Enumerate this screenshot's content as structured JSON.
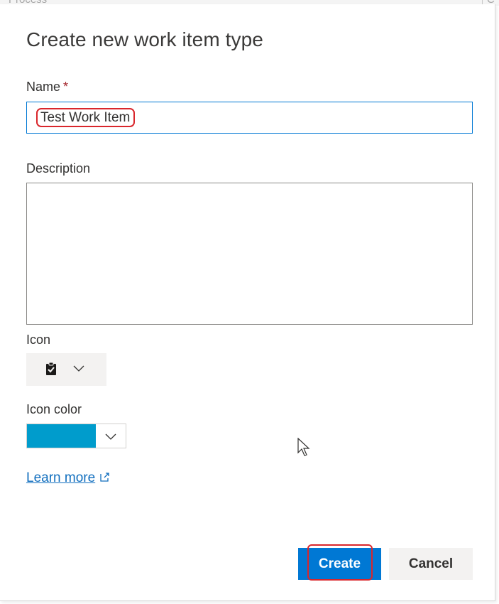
{
  "background": {
    "left_text": "Process",
    "right_text": "C"
  },
  "dialog": {
    "title": "Create new work item type",
    "name": {
      "label": "Name",
      "required_mark": "*",
      "value": "Test Work Item"
    },
    "description": {
      "label": "Description",
      "value": ""
    },
    "icon": {
      "label": "Icon",
      "selected_icon": "clipboard-check-icon"
    },
    "icon_color": {
      "label": "Icon color",
      "selected_color": "#009CCC"
    },
    "learn_more": {
      "label": "Learn more"
    },
    "buttons": {
      "create": "Create",
      "cancel": "Cancel"
    }
  },
  "colors": {
    "primary": "#0078D4",
    "required": "#A4262C",
    "link": "#106EBE",
    "highlight": "#D9262C"
  }
}
